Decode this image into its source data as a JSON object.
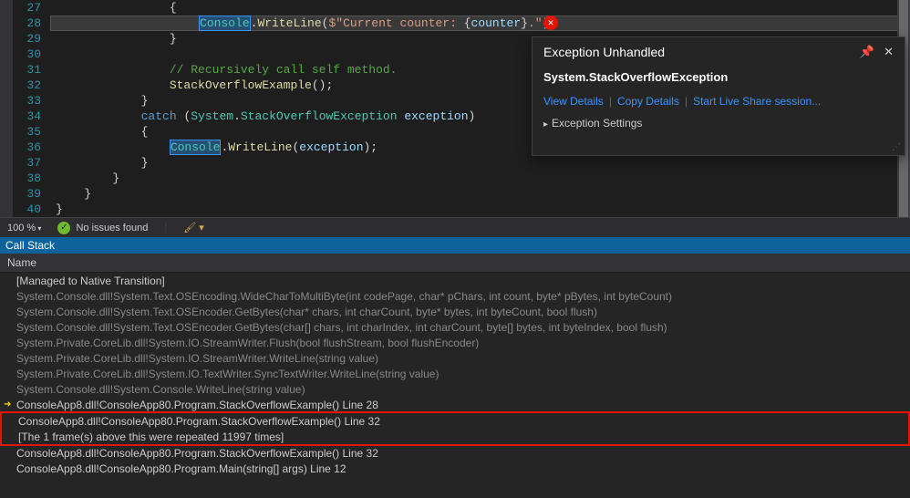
{
  "editor": {
    "lines": [
      {
        "num": 27,
        "indent": "                ",
        "tokens": [
          {
            "t": "{",
            "c": "punct"
          }
        ]
      },
      {
        "num": 28,
        "indent": "                    ",
        "highlighted": true,
        "tokens": [
          {
            "t": "Console",
            "c": "type sel-box"
          },
          {
            "t": ".",
            "c": "punct"
          },
          {
            "t": "WriteLine",
            "c": "method"
          },
          {
            "t": "(",
            "c": "punct"
          },
          {
            "t": "$\"Current counter: ",
            "c": "str"
          },
          {
            "t": "{",
            "c": "punct"
          },
          {
            "t": "counter",
            "c": "var"
          },
          {
            "t": "}",
            "c": "punct"
          },
          {
            "t": ".\"",
            "c": "str"
          },
          {
            "t": ");",
            "c": "punct"
          }
        ]
      },
      {
        "num": 29,
        "indent": "                ",
        "tokens": [
          {
            "t": "}",
            "c": "punct"
          }
        ]
      },
      {
        "num": 30,
        "indent": "",
        "tokens": []
      },
      {
        "num": 31,
        "indent": "                ",
        "tokens": [
          {
            "t": "// Recursively call self method.",
            "c": "comment"
          }
        ]
      },
      {
        "num": 32,
        "indent": "                ",
        "tokens": [
          {
            "t": "StackOverflowExample",
            "c": "method"
          },
          {
            "t": "();",
            "c": "punct"
          }
        ]
      },
      {
        "num": 33,
        "indent": "            ",
        "tokens": [
          {
            "t": "}",
            "c": "punct"
          }
        ]
      },
      {
        "num": 34,
        "indent": "            ",
        "tokens": [
          {
            "t": "catch",
            "c": "kw"
          },
          {
            "t": " (",
            "c": "punct"
          },
          {
            "t": "System",
            "c": "type"
          },
          {
            "t": ".",
            "c": "punct"
          },
          {
            "t": "StackOverflowException",
            "c": "type"
          },
          {
            "t": " ",
            "c": ""
          },
          {
            "t": "exception",
            "c": "var"
          },
          {
            "t": ")",
            "c": "punct"
          }
        ]
      },
      {
        "num": 35,
        "indent": "            ",
        "tokens": [
          {
            "t": "{",
            "c": "punct"
          }
        ]
      },
      {
        "num": 36,
        "indent": "                ",
        "tokens": [
          {
            "t": "Console",
            "c": "type sel-box"
          },
          {
            "t": ".",
            "c": "punct"
          },
          {
            "t": "WriteLine",
            "c": "method"
          },
          {
            "t": "(",
            "c": "punct"
          },
          {
            "t": "exception",
            "c": "var"
          },
          {
            "t": ");",
            "c": "punct"
          }
        ]
      },
      {
        "num": 37,
        "indent": "            ",
        "tokens": [
          {
            "t": "}",
            "c": "punct"
          }
        ]
      },
      {
        "num": 38,
        "indent": "        ",
        "tokens": [
          {
            "t": "}",
            "c": "punct"
          }
        ]
      },
      {
        "num": 39,
        "indent": "    ",
        "tokens": [
          {
            "t": "}",
            "c": "punct"
          }
        ]
      },
      {
        "num": 40,
        "indent": "",
        "tokens": [
          {
            "t": "}",
            "c": "punct"
          }
        ]
      }
    ]
  },
  "error_badge": "✕",
  "exception": {
    "title": "Exception Unhandled",
    "type": "System.StackOverflowException",
    "links": {
      "view": "View Details",
      "copy": "Copy Details",
      "live": "Start Live Share session..."
    },
    "settings": "Exception Settings"
  },
  "status": {
    "zoom": "100 %",
    "issues": "No issues found"
  },
  "callstack": {
    "title": "Call Stack",
    "header": "Name",
    "rows": [
      {
        "text": "[Managed to Native Transition]",
        "active": true
      },
      {
        "text": "System.Console.dll!System.Text.OSEncoding.WideCharToMultiByte(int codePage, char* pChars, int count, byte* pBytes, int byteCount)"
      },
      {
        "text": "System.Console.dll!System.Text.OSEncoder.GetBytes(char* chars, int charCount, byte* bytes, int byteCount, bool flush)"
      },
      {
        "text": "System.Console.dll!System.Text.OSEncoder.GetBytes(char[] chars, int charIndex, int charCount, byte[] bytes, int byteIndex, bool flush)"
      },
      {
        "text": "System.Private.CoreLib.dll!System.IO.StreamWriter.Flush(bool flushStream, bool flushEncoder)"
      },
      {
        "text": "System.Private.CoreLib.dll!System.IO.StreamWriter.WriteLine(string value)"
      },
      {
        "text": "System.Private.CoreLib.dll!System.IO.TextWriter.SyncTextWriter.WriteLine(string value)"
      },
      {
        "text": "System.Console.dll!System.Console.WriteLine(string value)"
      },
      {
        "text": "ConsoleApp8.dll!ConsoleApp80.Program.StackOverflowExample() Line 28",
        "active": true,
        "arrow": "yellow"
      },
      {
        "text": "ConsoleApp8.dll!ConsoleApp80.Program.StackOverflowExample() Line 32",
        "active": true,
        "redbox": true
      },
      {
        "text": "[The 1 frame(s) above this were repeated 11997 times]",
        "active": true,
        "redbox": true
      },
      {
        "text": "ConsoleApp8.dll!ConsoleApp80.Program.StackOverflowExample() Line 32",
        "active": true
      },
      {
        "text": "ConsoleApp8.dll!ConsoleApp80.Program.Main(string[] args) Line 12",
        "active": true
      }
    ]
  }
}
